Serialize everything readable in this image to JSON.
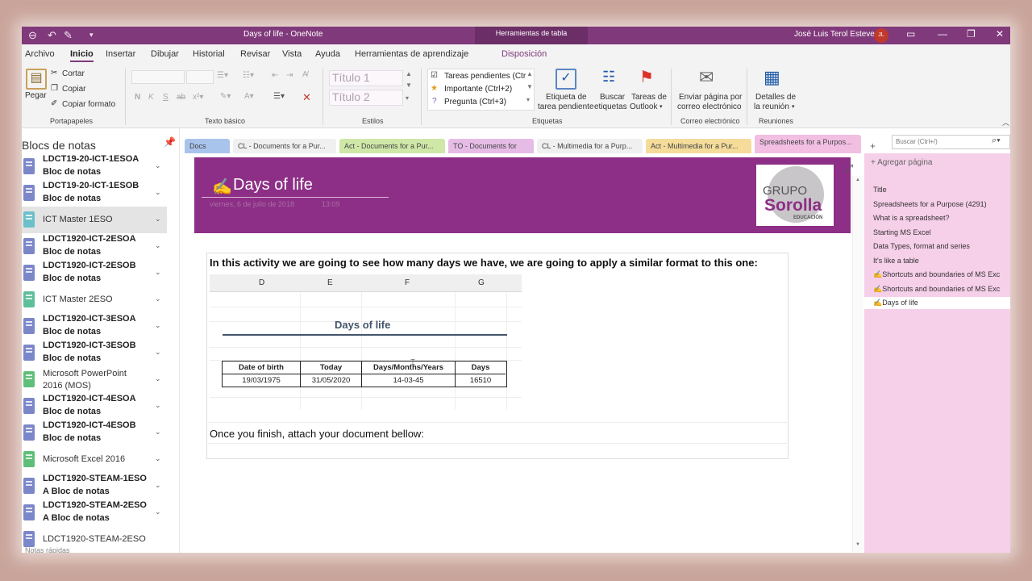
{
  "titlebar": {
    "doc_title": "Days of life  -  OneNote",
    "context_tab": "Herramientas de tabla",
    "user_name": "José Luis Terol Esteve",
    "user_initials": "JL"
  },
  "menu": [
    "Archivo",
    "Inicio",
    "Insertar",
    "Dibujar",
    "Historial",
    "Revisar",
    "Vista",
    "Ayuda",
    "Herramientas de aprendizaje",
    "Disposición"
  ],
  "ribbon": {
    "paste": "Pegar",
    "cut": "Cortar",
    "copy": "Copiar",
    "format_painter": "Copiar formato",
    "group_clipboard": "Portapapeles",
    "group_basic_text": "Texto básico",
    "style1": "Título 1",
    "style2": "Título 2",
    "group_styles": "Estilos",
    "tag1": "Tareas pendientes (Ctr",
    "tag2": "Importante (Ctrl+2)",
    "tag3": "Pregunta (Ctrl+3)",
    "todo_tag_l1": "Etiqueta de",
    "todo_tag_l2": "tarea pendiente",
    "find_tags_l1": "Buscar",
    "find_tags_l2": "etiquetas",
    "outlook_l1": "Tareas de",
    "outlook_l2": "Outlook",
    "group_tags": "Etiquetas",
    "email_l1": "Enviar página por",
    "email_l2": "correo electrónico",
    "group_email": "Correo electrónico",
    "meeting_l1": "Detalles de",
    "meeting_l2": "la reunión",
    "group_meetings": "Reuniones"
  },
  "notebooks": {
    "heading": "Blocs de notas",
    "items": [
      {
        "line1": "LDCT19-20-ICT-1ESOA",
        "line2": "Bloc de notas",
        "color": "#7b87c9"
      },
      {
        "line1": "LDCT19-20-ICT-1ESOB",
        "line2": "Bloc de notas",
        "color": "#7b87c9"
      },
      {
        "line1": "ICT Master 1ESO",
        "line2": "",
        "color": "#6cc0c9"
      },
      {
        "line1": "LDCT1920-ICT-2ESOA",
        "line2": "Bloc de notas",
        "color": "#7b87c9"
      },
      {
        "line1": "LDCT1920-ICT-2ESOB",
        "line2": "Bloc de notas",
        "color": "#7b87c9"
      },
      {
        "line1": "ICT Master 2ESO",
        "line2": "",
        "color": "#5fbf9a"
      },
      {
        "line1": "LDCT1920-ICT-3ESOA",
        "line2": "Bloc de notas",
        "color": "#7b87c9"
      },
      {
        "line1": "LDCT1920-ICT-3ESOB",
        "line2": "Bloc de notas",
        "color": "#7b87c9"
      },
      {
        "line1": "Microsoft PowerPoint 2016 (MOS)",
        "line2": "",
        "color": "#5fbf7a"
      },
      {
        "line1": "LDCT1920-ICT-4ESOA",
        "line2": "Bloc de notas",
        "color": "#7b87c9"
      },
      {
        "line1": "LDCT1920-ICT-4ESOB",
        "line2": "Bloc de notas",
        "color": "#7b87c9"
      },
      {
        "line1": "Microsoft Excel 2016",
        "line2": "",
        "color": "#5fbf7a"
      },
      {
        "line1": "LDCT1920-STEAM-1ESO",
        "line2": "A Bloc de notas",
        "color": "#7b87c9"
      },
      {
        "line1": "LDCT1920-STEAM-2ESO",
        "line2": "A Bloc de notas",
        "color": "#7b87c9"
      },
      {
        "line1": "LDCT1920-STEAM-2ESO",
        "line2": "",
        "color": "#7b87c9"
      }
    ],
    "quick_notes": "Notas rápidas"
  },
  "sections": [
    {
      "label": "Docs",
      "color": "#a9c4ec"
    },
    {
      "label": "CL - Documents for a Pur...",
      "color": "#f0f0f0"
    },
    {
      "label": "Act - Documents for a Pur...",
      "color": "#cfe8a8"
    },
    {
      "label": "TO - Documents for",
      "color": "#e6bce6"
    },
    {
      "label": "CL - Multimedia for a Purp...",
      "color": "#f0f0f0"
    },
    {
      "label": "Act - Multimedia for a Pur...",
      "color": "#f5dc9a"
    },
    {
      "label": "Spreadsheets for a Purpos...",
      "color": "#f2bfe3"
    }
  ],
  "search_placeholder": "Buscar (Ctrl+/)",
  "page": {
    "title": "Days of life",
    "date": "viernes, 6 de julio de 2018",
    "time": "13:09",
    "logo_line1": "GRUPO",
    "logo_line2": "Sorolla",
    "logo_line3": "EDUCACIÓN",
    "instruction": "In  this activity we are going to see how many days we have, we are going to apply a similar format to this one:",
    "sheet": {
      "columns": [
        "D",
        "E",
        "F",
        "G"
      ],
      "title": "Days of life",
      "headers": [
        "Date of birth",
        "Today",
        "Days/Months/Years",
        "Days"
      ],
      "values": [
        "19/03/1975",
        "31/05/2020",
        "14-03-45",
        "16510"
      ]
    },
    "finish": "Once you finish, attach your document bellow:"
  },
  "pages_panel": {
    "add_page": "Agregar página",
    "items": [
      "Title",
      "Spreadsheets for a Purpose (4291)",
      "What is a spreadsheet?",
      "Starting MS Excel",
      "Data Types, format and series",
      "It's like a table",
      "Shortcuts and boundaries of MS Exc",
      "Shortcuts and boundaries of MS Exc",
      "Days of life"
    ]
  }
}
